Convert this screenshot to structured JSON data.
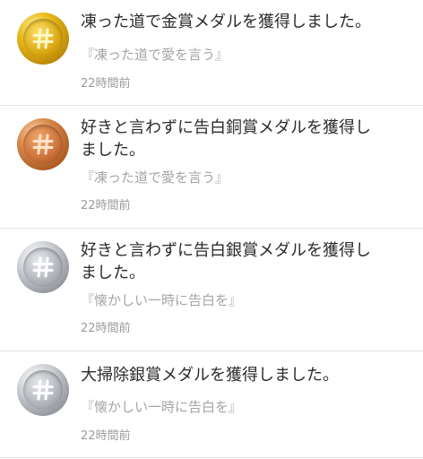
{
  "notifications": [
    {
      "medal": "gold",
      "title": "凍った道で金賞メダルを獲得しました。",
      "quote": "『凍った道で愛を言う』",
      "time": "22時間前"
    },
    {
      "medal": "bronze",
      "title": "好きと言わずに告白銅賞メダルを獲得しました。",
      "quote": "『凍った道で愛を言う』",
      "time": "22時間前"
    },
    {
      "medal": "silver",
      "title": "好きと言わずに告白銀賞メダルを獲得しました。",
      "quote": "『懐かしい一時に告白を』",
      "time": "22時間前"
    },
    {
      "medal": "silver",
      "title": "大掃除銀賞メダルを獲得しました。",
      "quote": "『懐かしい一時に告白を』",
      "time": "22時間前"
    }
  ],
  "icons": {
    "medal": "hashtag-medal-icon"
  },
  "colors": {
    "gold": "#d8a510",
    "bronze": "#c9703a",
    "silver": "#aeb2b8",
    "title_text": "#2b2b2b",
    "quote_text": "#a5a5a5",
    "time_text": "#9b9b9b"
  }
}
